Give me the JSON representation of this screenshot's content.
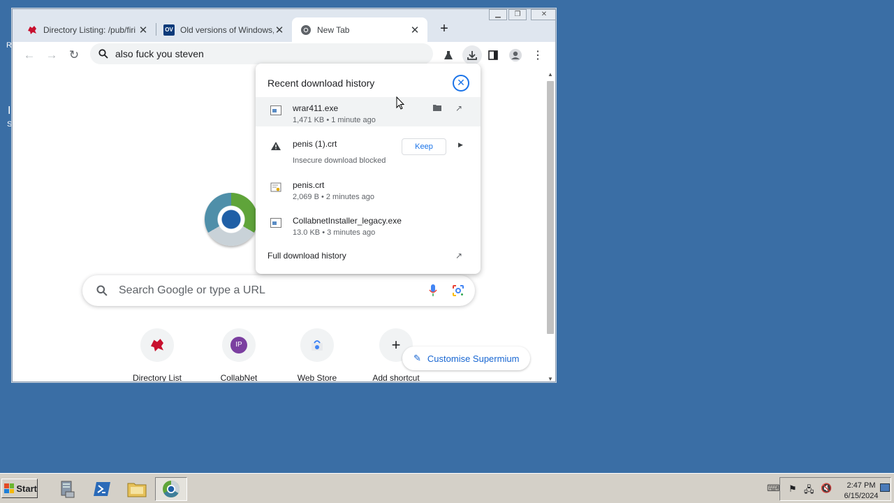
{
  "browser": {
    "tabs": [
      {
        "title": "Directory Listing: /pub/firi",
        "favicon": "red-creature-icon"
      },
      {
        "title": "Old versions of Windows,",
        "favicon": "ov-logo-icon"
      },
      {
        "title": "New Tab",
        "favicon": "chromium-icon"
      }
    ],
    "omnibox_text": "also fuck you steven"
  },
  "newtab": {
    "search_placeholder": "Search Google or type a URL",
    "shortcuts": [
      {
        "label": "Directory List",
        "icon": "red-creature-icon"
      },
      {
        "label": "CollabNet",
        "icon": "collabnet-icon"
      },
      {
        "label": "Web Store",
        "icon": "webstore-icon"
      },
      {
        "label": "Add shortcut",
        "icon": "plus-icon"
      }
    ],
    "customise_label": "Customise Supermium"
  },
  "downloads": {
    "title": "Recent download history",
    "items": [
      {
        "name": "wrar411.exe",
        "meta": "1,471 KB • 1 minute ago"
      },
      {
        "name": "penis (1).crt",
        "meta": "Insecure download blocked",
        "action": "Keep"
      },
      {
        "name": "penis.crt",
        "meta": "2,069 B • 2 minutes ago"
      },
      {
        "name": "CollabnetInstaller_legacy.exe",
        "meta": "13.0 KB • 3 minutes ago"
      }
    ],
    "full_history_label": "Full download history"
  },
  "taskbar": {
    "start_label": "Start",
    "time": "2:47 PM",
    "date": "6/15/2024"
  },
  "colors": {
    "desktop": "#3a6ea5",
    "accent": "#1a73e8"
  }
}
